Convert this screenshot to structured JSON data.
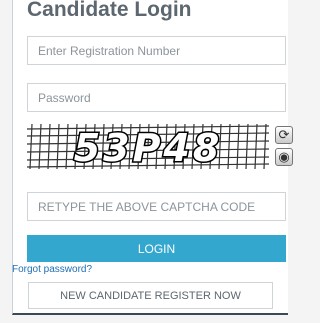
{
  "form": {
    "title": "Candidate Login",
    "registration_placeholder": "Enter Registration Number",
    "password_placeholder": "Password",
    "captcha_text": "53P48",
    "captcha_input_placeholder": "RETYPE THE ABOVE CAPTCHA CODE",
    "login_label": "LOGIN",
    "forgot_label": "Forgot password?",
    "register_label": "NEW CANDIDATE REGISTER NOW"
  },
  "icons": {
    "refresh": "refresh-icon",
    "audio": "audio-icon"
  },
  "colors": {
    "primary_button": "#34a7cf",
    "link": "#1f6fb5",
    "title": "#5d6770"
  }
}
